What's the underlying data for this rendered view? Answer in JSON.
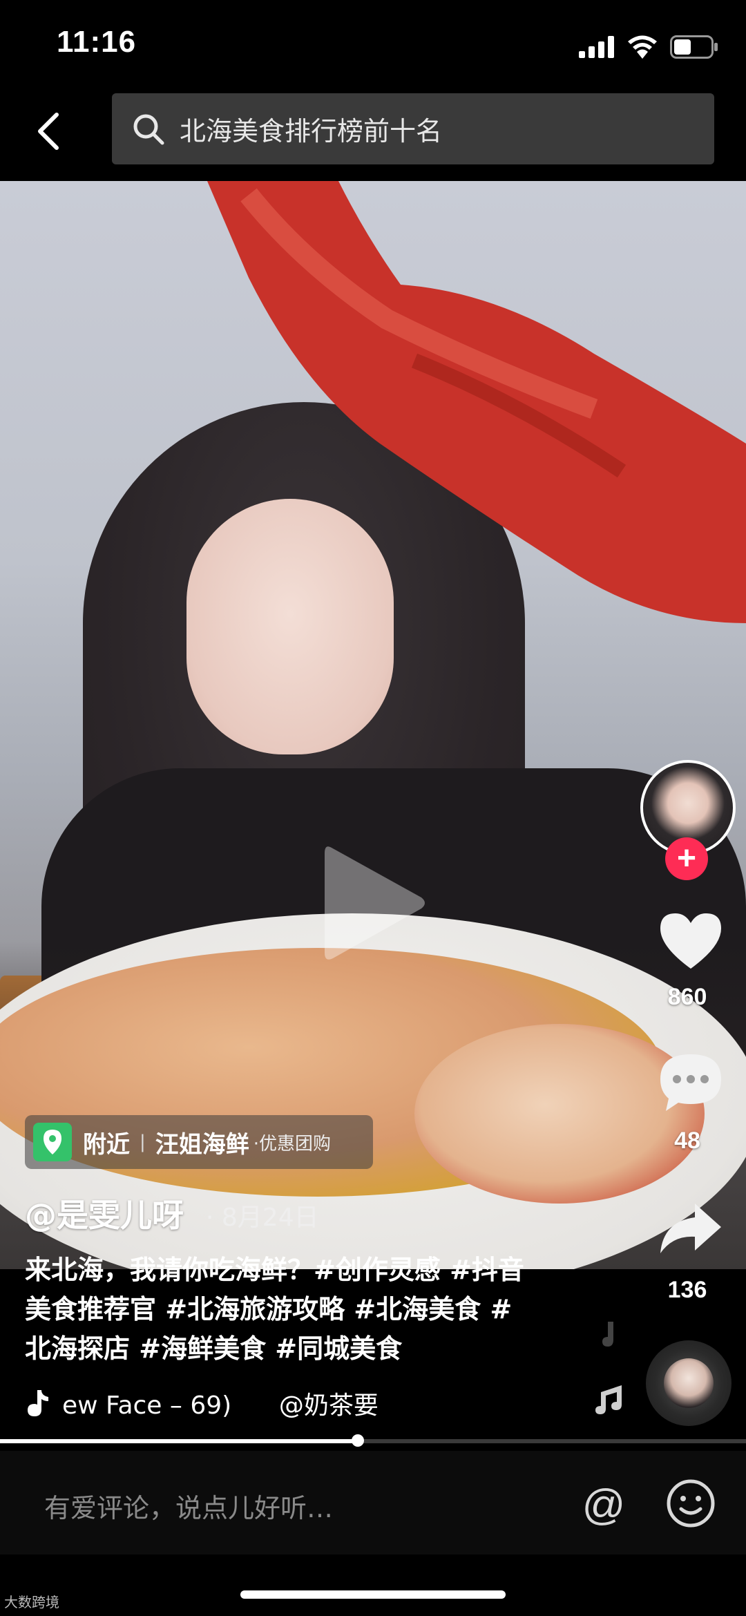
{
  "status_bar": {
    "time": "11:16"
  },
  "header": {
    "search_text": "北海美食排行榜前十名"
  },
  "location": {
    "tag": "附近",
    "name": "汪姐海鲜",
    "suffix": "·优惠团购"
  },
  "post": {
    "author": "@是雯儿呀",
    "date": "· 8月24日",
    "caption": "来北海，我请你吃海鲜？#创作灵感 #抖音美食推荐官 #北海旅游攻略 #北海美食 #北海探店 #海鲜美食 #同城美食",
    "music": "ew Face – 69)      @奶茶要"
  },
  "actions": {
    "likes": "860",
    "comments": "48",
    "shares": "136"
  },
  "progress": {
    "fraction": 0.48
  },
  "comment_bar": {
    "placeholder": "有爱评论，说点儿好听…"
  },
  "watermark": "大数跨境",
  "colors": {
    "follow": "#fe2c55",
    "location_pin": "#34c26a"
  },
  "icons": [
    "signal-icon",
    "wifi-icon",
    "battery-icon",
    "back-icon",
    "search-icon",
    "play-icon",
    "heart-icon",
    "comment-icon",
    "share-icon",
    "music-note-icon",
    "at-icon",
    "emoji-icon"
  ]
}
